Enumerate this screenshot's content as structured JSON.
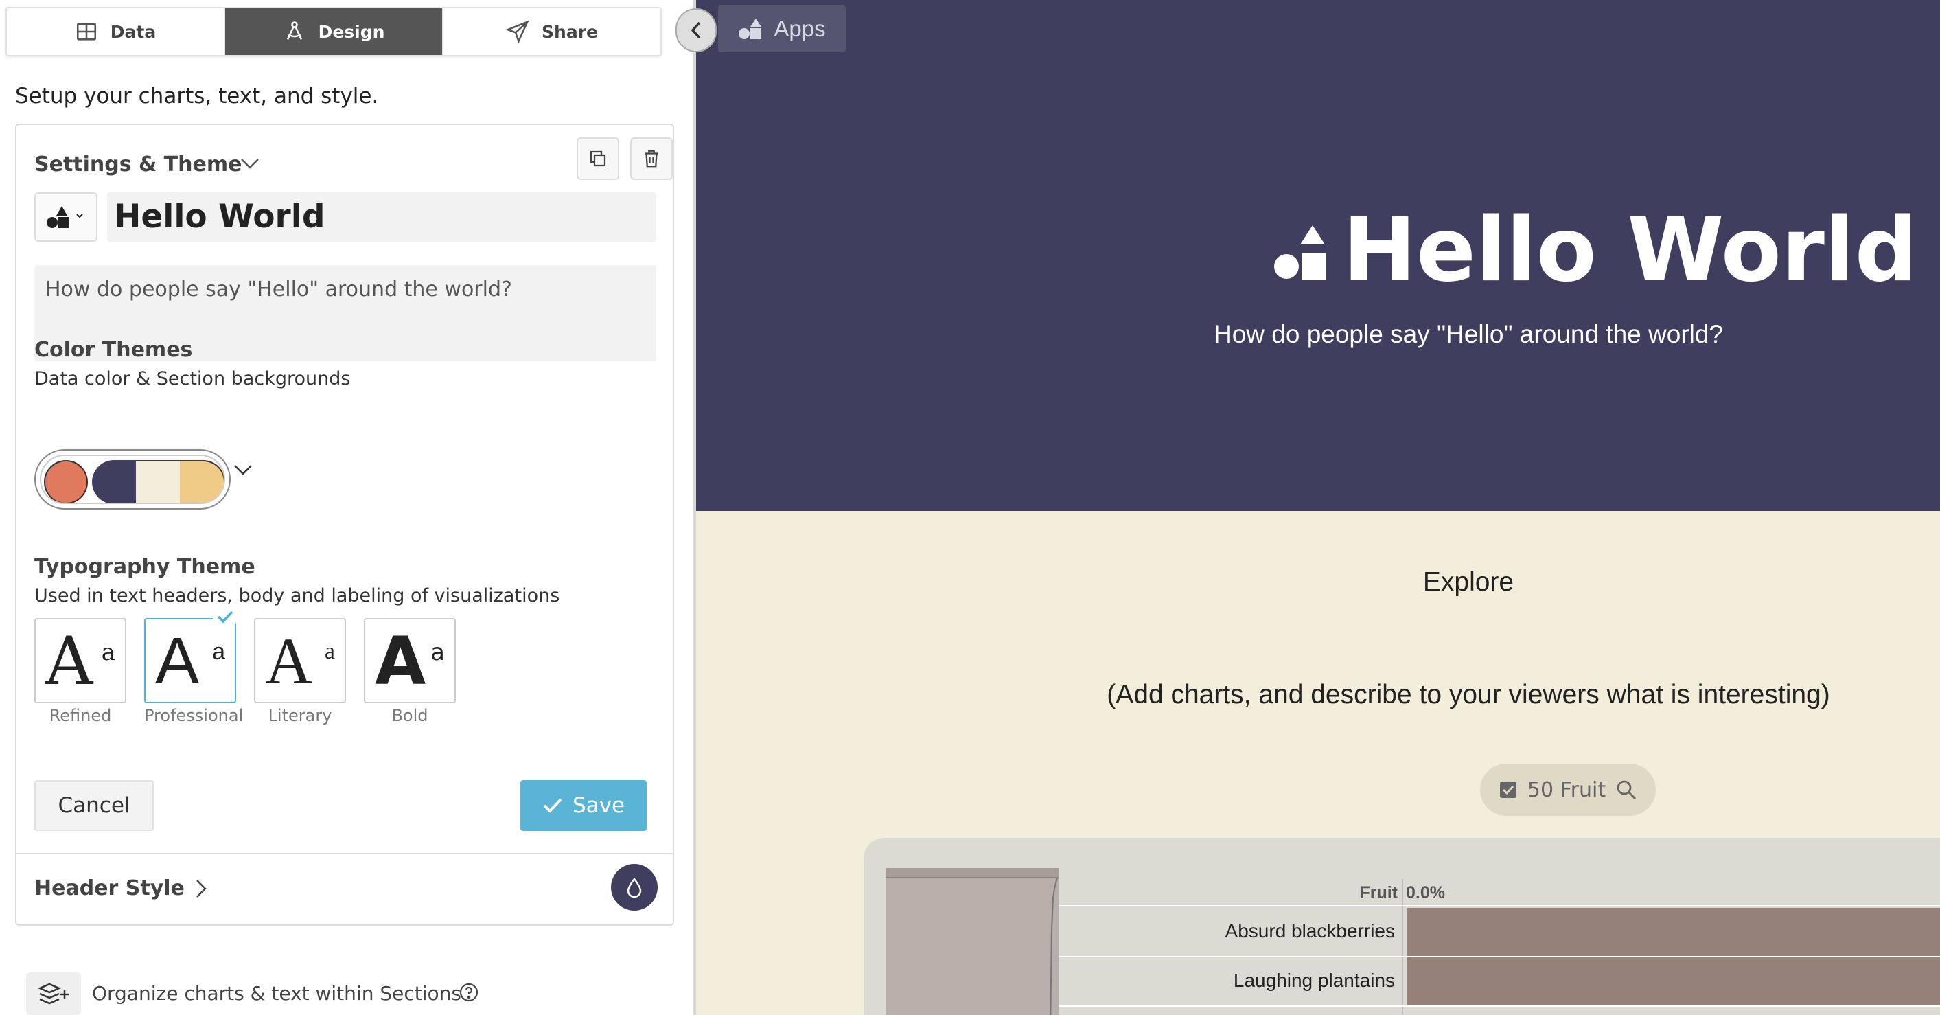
{
  "tabs": [
    {
      "label": "Data",
      "icon": "table-icon"
    },
    {
      "label": "Design",
      "icon": "design-compass-icon",
      "active": true
    },
    {
      "label": "Share",
      "icon": "paper-plane-icon"
    }
  ],
  "intro": "Setup your charts, text, and style.",
  "settings": {
    "heading": "Settings & Theme",
    "title_value": "Hello World",
    "description_value": "How do people say \"Hello\" around the world?",
    "color_themes": {
      "label": "Color Themes",
      "sublabel": "Data color & Section backgrounds",
      "swatches": [
        "#df7a5f",
        "#3f3e5e",
        "#f3eddb",
        "#f0ca87"
      ]
    },
    "typography": {
      "label": "Typography Theme",
      "sublabel": "Used in text headers, body and labeling of visualizations",
      "options": [
        {
          "label": "Refined",
          "big": "A",
          "small": "a"
        },
        {
          "label": "Professional",
          "big": "A",
          "small": "a",
          "selected": true
        },
        {
          "label": "Literary",
          "big": "A",
          "small": "a"
        },
        {
          "label": "Bold",
          "big": "A",
          "small": "a"
        }
      ]
    },
    "cancel_label": "Cancel",
    "save_label": "Save"
  },
  "header_style": "Header Style",
  "organize_text": "Organize charts & text within Sections",
  "preview": {
    "apps_label": "Apps",
    "title": "Hello World",
    "subtitle": "How do people say \"Hello\" around the world?",
    "hero_bg": "#3f3e5e",
    "section_bg": "#f3eddb",
    "explore": "Explore",
    "add_charts": "(Add charts, and describe to your viewers what is interesting)",
    "filter_label": "50 Fruit",
    "fruit_header": "Fruit",
    "pct_header": "0.0%"
  },
  "chart_data": {
    "type": "bar",
    "categories": [
      "Absurd blackberries",
      "Laughing plantains"
    ],
    "xlabel": "Fruit",
    "bar_color": "#968178"
  }
}
